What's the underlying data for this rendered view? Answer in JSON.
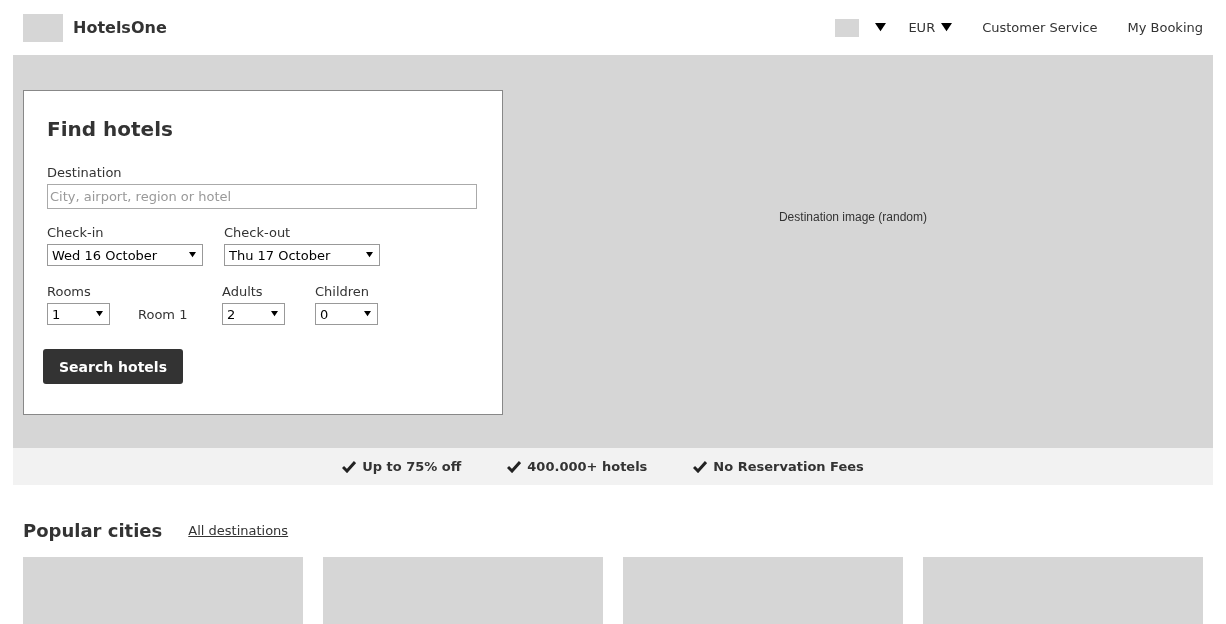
{
  "header": {
    "brand": "HotelsOne",
    "currency": "EUR",
    "links": [
      "Customer Service",
      "My Booking"
    ]
  },
  "hero": {
    "image_label": "Destination image (random)"
  },
  "search_form": {
    "title": "Find hotels",
    "destination": {
      "label": "Destination",
      "placeholder": "City, airport, region or hotel"
    },
    "checkin": {
      "label": "Check-in",
      "value": "Wed 16 October"
    },
    "checkout": {
      "label": "Check-out",
      "value": "Thu 17 October"
    },
    "rooms": {
      "label": "Rooms",
      "value": "1"
    },
    "room_label": "Room 1",
    "adults": {
      "label": "Adults",
      "value": "2"
    },
    "children": {
      "label": "Children",
      "value": "0"
    },
    "button": "Search hotels"
  },
  "benefits": [
    "Up to 75% off",
    "400.000+ hotels",
    "No Reservation Fees"
  ],
  "popular": {
    "title": "Popular cities",
    "link": "All destinations",
    "cards": [
      {
        "kind": "placeholder"
      },
      {
        "kind": "placeholder"
      },
      {
        "kind": "placeholder"
      },
      {
        "kind": "placeholder"
      }
    ]
  }
}
